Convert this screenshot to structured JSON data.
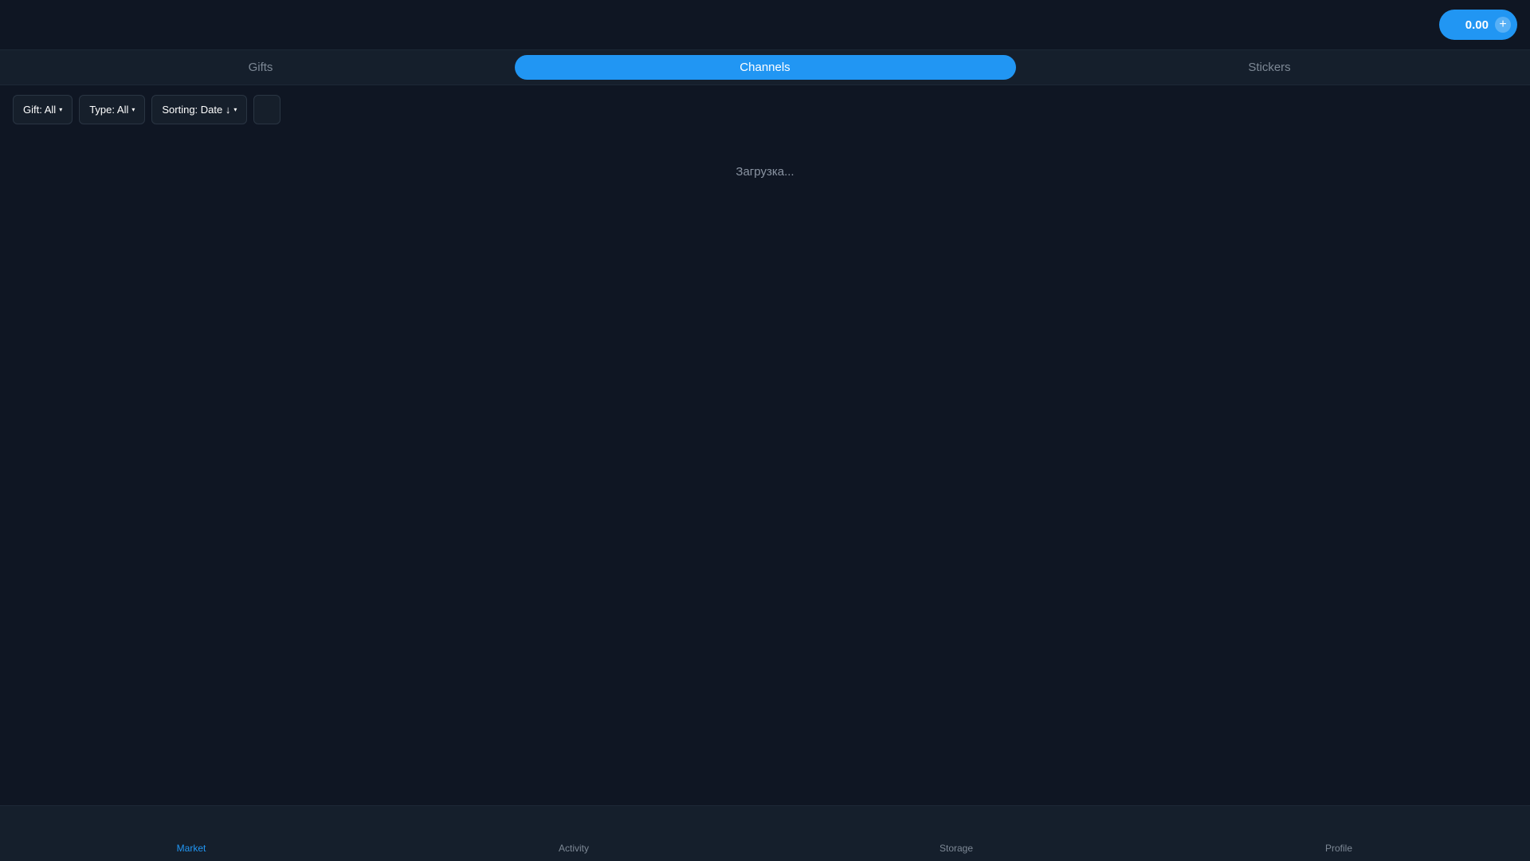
{
  "header": {
    "balance": "0.00",
    "add_symbol": "+"
  },
  "tabs": [
    {
      "label": "Gifts",
      "active": false
    },
    {
      "label": "Channels",
      "active": true
    },
    {
      "label": "Stickers",
      "active": false
    }
  ],
  "filters": {
    "gift": "Gift: All",
    "type": "Type: All",
    "sorting": "Sorting: Date ↓",
    "caret": "▾"
  },
  "status": {
    "loading_text": "Загрузка..."
  },
  "bottom_nav": [
    {
      "label": "Market",
      "active": true
    },
    {
      "label": "Activity",
      "active": false
    },
    {
      "label": "Storage",
      "active": false
    },
    {
      "label": "Profile",
      "active": false
    }
  ],
  "colors": {
    "background": "#0f1623",
    "panel": "#151f2c",
    "accent": "#2196f3",
    "muted_text": "#7d8895"
  }
}
